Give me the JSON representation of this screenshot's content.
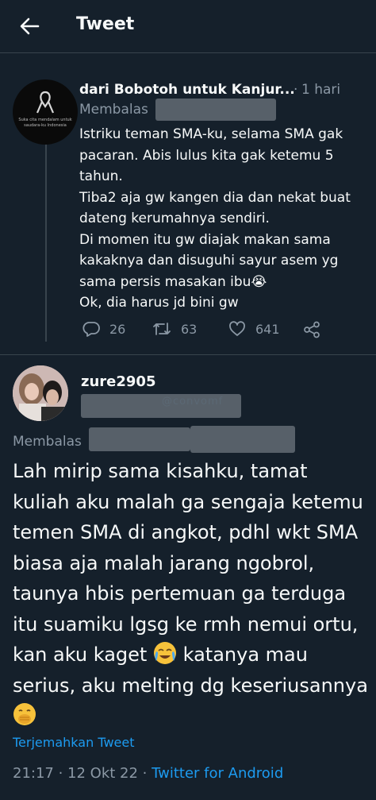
{
  "header": {
    "title": "Tweet"
  },
  "parent_tweet": {
    "author_name": "dari Bobotoh untuk Kanjur...",
    "separator": "·",
    "time": "1 hari",
    "reply_prefix": "Membalas",
    "avatar_caption": "Suka cita mendalam untuk saudara-ku Indonesia",
    "body_lines": [
      "Istriku teman SMA-ku, selama SMA gak pacaran. Abis lulus kita gak ketemu 5 tahun.",
      "Tiba2 aja gw kangen dia dan nekat buat dateng kerumahnya sendiri.",
      "Di momen itu gw diajak makan sama kakaknya dan disuguhi sayur asem yg sama persis masakan ibu😭",
      "Ok, dia harus jd bini gw"
    ],
    "stats": {
      "replies": "26",
      "retweets": "63",
      "likes": "641"
    }
  },
  "main_tweet": {
    "username": "zure2905",
    "watermark": "@convomf",
    "reply_prefix": "Membalas",
    "body_part1": "Lah mirip sama kisahku, tamat kuliah aku malah ga sengaja ketemu temen SMA di angkot, pdhl wkt SMA biasa aja malah jarang ngobrol, taunya hbis pertemuan ga terduga itu suamiku lgsg ke rmh nemui ortu, kan aku kaget",
    "body_part2": "katanya mau serius, aku melting dg keseriusannya",
    "translate_label": "Terjemahkan Tweet",
    "meta_time": "21:17 · 12 Okt 22 ·",
    "meta_source": "Twitter for Android"
  },
  "colors": {
    "background": "#15202b",
    "text": "#f7f9f9",
    "secondary": "#8b98a5",
    "accent": "#1d9bf0",
    "border": "#38444d"
  }
}
